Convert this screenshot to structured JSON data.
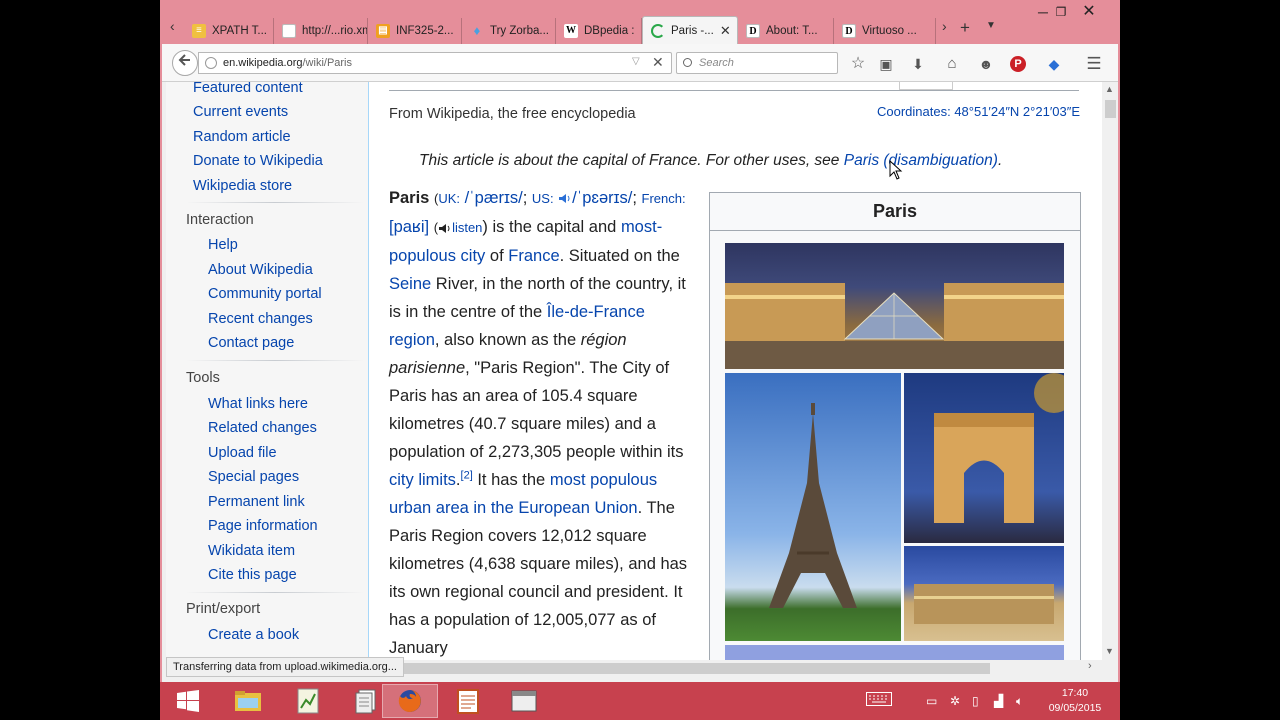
{
  "browser": {
    "tabs": [
      {
        "label": "XPATH T...",
        "icon": "page-icon",
        "color": "#f0c040"
      },
      {
        "label": "http://...rio.xml",
        "icon": "blank-icon",
        "color": "#ffffff"
      },
      {
        "label": "INF325-2...",
        "icon": "doc-icon",
        "color": "#f0a020"
      },
      {
        "label": "Try Zorba...",
        "icon": "zorba-icon",
        "color": "#4aa0e0"
      },
      {
        "label": "DBpedia :",
        "icon": "wikipedia-icon",
        "color": "#ffffff"
      },
      {
        "label": "Paris -...",
        "icon": "loading-icon",
        "color": "#2aa84a"
      },
      {
        "label": "About: T...",
        "icon": "dbpedia-icon",
        "color": "#ffffff"
      },
      {
        "label": "Virtuoso ...",
        "icon": "dbpedia-icon",
        "color": "#ffffff"
      }
    ],
    "url_host": "en.wikipedia.org",
    "url_path": "/wiki/Paris",
    "search_placeholder": "Search",
    "status": "Transferring data from upload.wikimedia.org..."
  },
  "sidebar": {
    "top_links": [
      "Featured content",
      "Current events",
      "Random article",
      "Donate to Wikipedia",
      "Wikipedia store"
    ],
    "interaction_heading": "Interaction",
    "interaction": [
      "Help",
      "About Wikipedia",
      "Community portal",
      "Recent changes",
      "Contact page"
    ],
    "tools_heading": "Tools",
    "tools": [
      "What links here",
      "Related changes",
      "Upload file",
      "Special pages",
      "Permanent link",
      "Page information",
      "Wikidata item",
      "Cite this page"
    ],
    "print_heading": "Print/export",
    "print": [
      "Create a book"
    ]
  },
  "article": {
    "tagline": "From Wikipedia, the free encyclopedia",
    "coords_label": "Coordinates:",
    "coords_value": "48°51′24″N 2°21′03″E",
    "hatnote_text": "This article is about the capital of France. For other uses, see",
    "hatnote_link": "Paris (disambiguation)",
    "hatnote_end": ".",
    "title_word": "Paris",
    "pron_uk": "UK:",
    "pron_uk_ipa": "/ˈpærɪs/",
    "pron_us": "US:",
    "pron_us_ipa": "/ˈpɛərɪs/",
    "pron_fr": "French:",
    "pron_fr_ipa": "[paʁi]",
    "listen": "listen",
    "t1": ") is the capital and",
    "l_most_populous_city": "most-populous city",
    "t_of": "of",
    "l_france": "France",
    "t2": ". Situated on the",
    "l_seine": "Seine",
    "t3": "River, in the north of the country, it is in the centre of the",
    "l_iledefrance": "Île-de-France region",
    "t4": ", also known as the",
    "t_region_it": "région parisienne",
    "t5": ", \"Paris Region\". The City of Paris has an area of 105.4 square kilometres (40.7 square miles) and a population of 2,273,305 people within its",
    "l_city_limits": "city limits",
    "t6": ".",
    "ref2": "[2]",
    "t7": "It has the",
    "l_urban_area": "most populous urban area in the European Union",
    "t8": ". The Paris Region covers 12,012 square kilometres (4,638 square miles), and has its own regional council and president. It has a population of 12,005,077 as of January"
  },
  "infobox": {
    "title": "Paris",
    "images": [
      "louvre-pyramid-photo",
      "eiffel-tower-photo",
      "arc-de-triomphe-photo",
      "versailles-photo"
    ]
  },
  "taskbar": {
    "clock_time": "17:40",
    "clock_date": "09/05/2015"
  },
  "colors": {
    "accent": "#e58e9a",
    "taskbar": "#c7414e",
    "link": "#0645ad"
  }
}
